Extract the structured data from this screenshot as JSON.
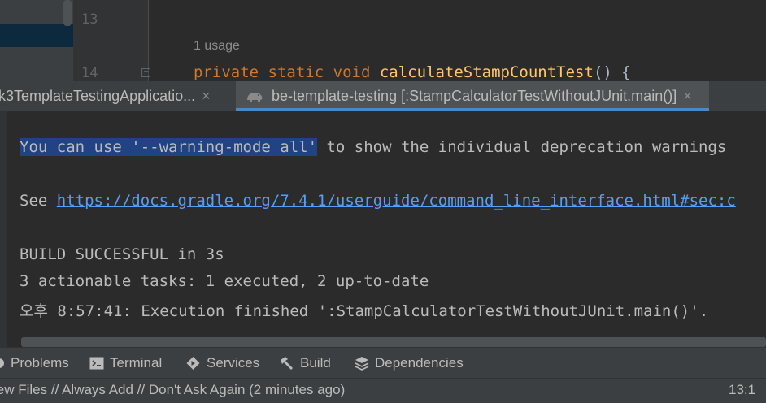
{
  "editor": {
    "line_numbers": [
      "13",
      "14"
    ],
    "usage_hint": "1 usage",
    "code": {
      "kw1": "private",
      "kw2": "static",
      "kw3": "void",
      "method": "calculateStampCountTest",
      "suffix": "() {"
    }
  },
  "run_tabs": [
    {
      "label": "k3TemplateTestingApplicatio...",
      "close": "×"
    },
    {
      "label": "be-template-testing [:StampCalculatorTestWithoutJUnit.main()]",
      "close": "×",
      "icon": "gradle-elephant-icon"
    }
  ],
  "console": {
    "line1_selected": "You can use '--warning-mode all'",
    "line1_rest": " to show the individual deprecation warnings",
    "line2_prefix": "See ",
    "line2_link": "https://docs.gradle.org/7.4.1/userguide/command_line_interface.html#sec:c",
    "line3": "BUILD SUCCESSFUL in 3s",
    "line4": "3 actionable tasks: 1 executed, 2 up-to-date",
    "line5": "오후 8:57:41: Execution finished ':StampCalculatorTestWithoutJUnit.main()'."
  },
  "tool_windows": [
    {
      "label": "Problems",
      "icon": "problems-icon"
    },
    {
      "label": "Terminal",
      "icon": "terminal-icon"
    },
    {
      "label": "Services",
      "icon": "services-icon"
    },
    {
      "label": "Build",
      "icon": "hammer-icon"
    },
    {
      "label": "Dependencies",
      "icon": "dependencies-icon"
    }
  ],
  "status_bar": {
    "message": "iew Files // Always Add // Don't Ask Again (2 minutes ago)",
    "caret_position": "13:1"
  },
  "colors": {
    "background": "#2b2b2b",
    "panel": "#3c3f41",
    "selection": "#214283",
    "link": "#589df6",
    "keyword": "#cc7832",
    "method": "#ffc66d",
    "active_tab_underline": "#4a88c7"
  }
}
